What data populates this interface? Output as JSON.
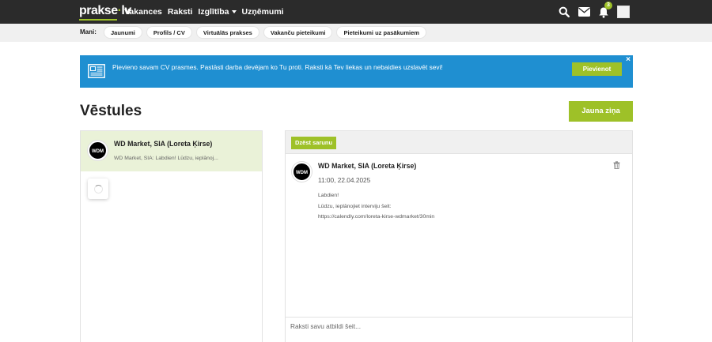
{
  "topbar": {
    "logo_main": "prakse",
    "logo_tld": "lv",
    "nav": [
      {
        "label": "Vakances"
      },
      {
        "label": "Raksti"
      },
      {
        "label": "Izglītība"
      },
      {
        "label": "Uzņēmumi"
      }
    ],
    "notification_count": "3",
    "icons": [
      "search-icon",
      "mail-icon",
      "bell-icon",
      "avatar"
    ]
  },
  "subbar": {
    "mani_label": "Mani:",
    "pills": [
      "Jaunumi",
      "Profils / CV",
      "Virtuālās prakses",
      "Vakanču pieteikumi",
      "Pieteikumi uz pasākumiem"
    ]
  },
  "banner": {
    "text": "Pievieno savam CV prasmes. Pastāsti darba devējam ko Tu proti. Raksti kā Tev liekas un nebaidies uzslavēt sevi!",
    "button": "Pievienot",
    "close": "×"
  },
  "page": {
    "title": "Vēstules",
    "new_button": "Jauna ziņa"
  },
  "conversations": [
    {
      "logo_text": "WDM",
      "name": "WD Market, SIA (Loreta Ķirse)",
      "preview": "WD Market, SIA: Labdien! Lūdzu, ieplānoj..."
    }
  ],
  "thread": {
    "delete_button": "Dzēst sarunu",
    "message": {
      "logo_text": "WDM",
      "name": "WD Market, SIA (Loreta Ķirse)",
      "date": "11:00, 22.04.2025",
      "lines": [
        "Labdien!",
        "Lūdzu, ieplānojiet interviju šeit:",
        "https://calendly.com/loreta-kirse-wdmarket/30min"
      ]
    },
    "reply_placeholder": "Raksti savu atbildi šeit..."
  },
  "colors": {
    "topbar": "#2b2b2b",
    "accent_green": "#9ec128",
    "banner_blue": "#1f8fd1",
    "selected_row": "#eaf2d8"
  }
}
